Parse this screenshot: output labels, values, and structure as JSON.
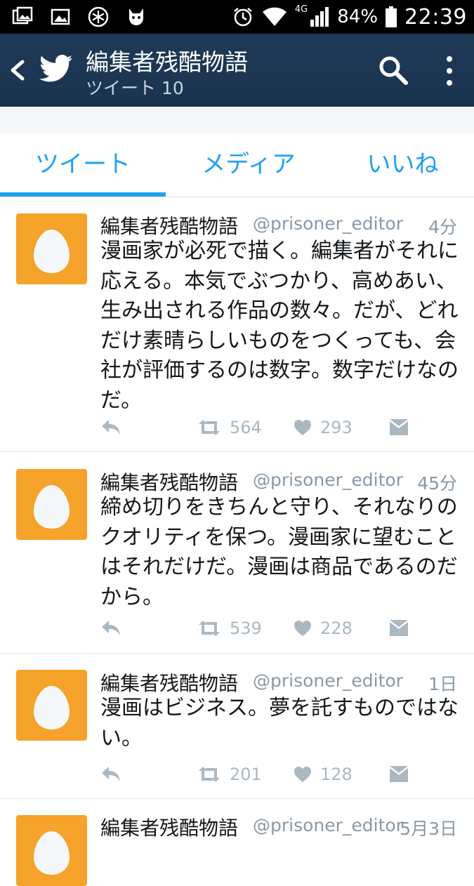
{
  "status_bar": {
    "battery": "84%",
    "time": "22:39",
    "network": "4G",
    "icons": [
      "gallery-icon",
      "image-icon",
      "snowflake-icon",
      "cat-icon",
      "alarm-icon",
      "wifi-icon",
      "signal-icon",
      "battery-icon"
    ]
  },
  "header": {
    "title": "編集者残酷物語",
    "subtitle": "ツイート 10",
    "icons": [
      "back-icon",
      "twitter-bird-icon",
      "search-icon",
      "more-vert-icon"
    ]
  },
  "tabs": [
    {
      "label": "ツイート",
      "active": true
    },
    {
      "label": "メディア",
      "active": false
    },
    {
      "label": "いいね",
      "active": false
    }
  ],
  "colors": {
    "accent": "#1da1f2",
    "header_bg": "#1b3652",
    "avatar_bg": "#f5a32a"
  },
  "tweets": [
    {
      "name": "編集者残酷物語",
      "handle": "@prisoner_editor",
      "time": "4分",
      "text": "漫画家が必死で描く。編集者がそれに\n応える。本気でぶつかり、高めあい、\n生み出される作品の数々。だが、どれ\nだけ素晴らしいものをつくっても、会\n社が評価するのは数字。数字だけなの\nだ。",
      "retweets": "564",
      "likes": "293"
    },
    {
      "name": "編集者残酷物語",
      "handle": "@prisoner_editor",
      "time": "45分",
      "text": "締め切りをきちんと守り、それなりの\nクオリティを保つ。漫画家に望むこと\nはそれだけだ。漫画は商品であるのだ\nから。",
      "retweets": "539",
      "likes": "228"
    },
    {
      "name": "編集者残酷物語",
      "handle": "@prisoner_editor",
      "time": "1日",
      "text": "漫画はビジネス。夢を託すものではな\nい。",
      "retweets": "201",
      "likes": "128"
    },
    {
      "name": "編集者残酷物語",
      "handle": "@prisoner_editor",
      "time": "5月3日",
      "text": "",
      "retweets": "",
      "likes": ""
    }
  ]
}
